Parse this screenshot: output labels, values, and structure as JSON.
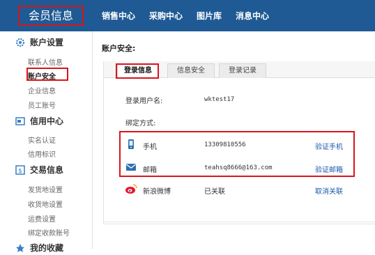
{
  "header": {
    "brand": "会员信息",
    "nav": [
      "销售中心",
      "采购中心",
      "图片库",
      "消息中心"
    ]
  },
  "sidebar": {
    "sections": [
      {
        "title": "账户设置",
        "icon": "gear-icon",
        "items": [
          "联系人信息",
          "账户安全",
          "企业信息",
          "员工账号"
        ]
      },
      {
        "title": "信用中心",
        "icon": "credit-icon",
        "items": [
          "实名认证",
          "信用标识"
        ]
      },
      {
        "title": "交易信息",
        "icon": "trade-icon",
        "items": [
          "发货地设置",
          "收货地设置",
          "运费设置",
          "绑定收款账号"
        ]
      },
      {
        "title": "我的收藏",
        "icon": "favorite-icon",
        "items": []
      }
    ],
    "active_item": "账户安全"
  },
  "main": {
    "title": "账户安全:",
    "tabs": [
      "登录信息",
      "信息安全",
      "登录记录"
    ],
    "active_tab": "登录信息",
    "login_user_label": "登录用户名:",
    "login_user_value": "wktest17",
    "bind_label": "绑定方式:",
    "bindings": [
      {
        "icon": "phone-icon",
        "label": "手机",
        "value": "13309810556",
        "action": "验证手机"
      },
      {
        "icon": "email-icon",
        "label": "邮箱",
        "value": "teahsq8666@163.com",
        "action": "验证邮箱"
      },
      {
        "icon": "weibo-icon",
        "label": "新浪微博",
        "value": "已关联",
        "action": "取消关联"
      }
    ]
  },
  "colors": {
    "topbar": "#1f5a94",
    "highlight": "#d9141b",
    "link": "#1a5aa8"
  }
}
